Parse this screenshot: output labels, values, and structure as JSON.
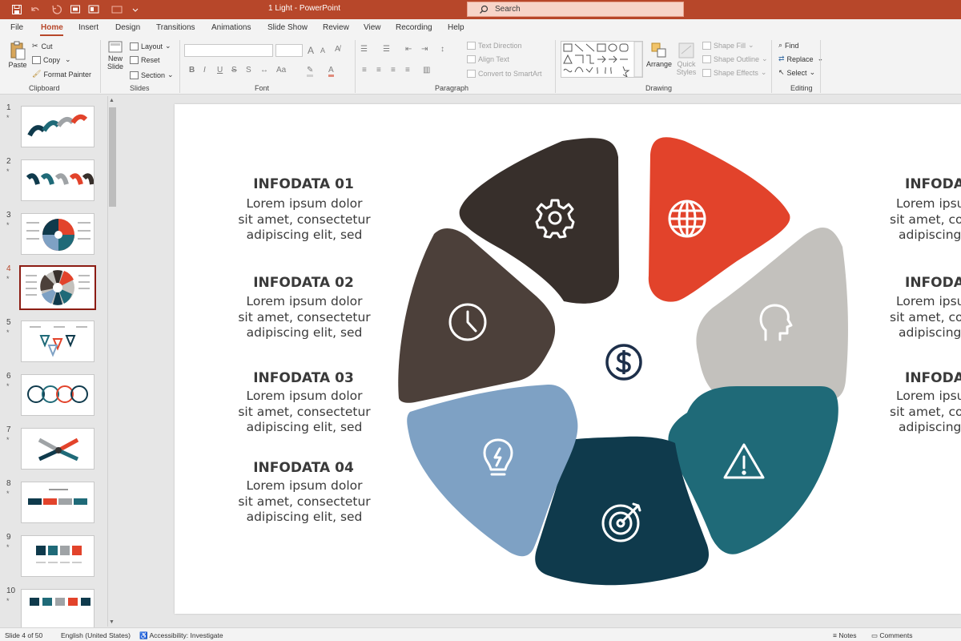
{
  "title_bar": {
    "doc_title": "1 Light  -  PowerPoint",
    "search_placeholder": "Search",
    "bg_color": "#b7472a"
  },
  "tabs": [
    "File",
    "Home",
    "Insert",
    "Design",
    "Transitions",
    "Animations",
    "Slide Show",
    "Review",
    "View",
    "Recording",
    "Help"
  ],
  "ribbon": {
    "clipboard": {
      "paste": "Paste",
      "cut": "Cut",
      "copy": "Copy",
      "format_painter": "Format Painter",
      "label": "Clipboard"
    },
    "slides": {
      "new_slide_1": "New",
      "new_slide_2": "Slide",
      "layout": "Layout",
      "reset": "Reset",
      "section": "Section",
      "label": "Slides"
    },
    "font": {
      "label": "Font",
      "bold": "B",
      "italic": "I",
      "underline": "U",
      "strike": "S",
      "grow": "A",
      "shrink": "A"
    },
    "paragraph": {
      "text_direction": "Text Direction",
      "align_text": "Align Text",
      "smartart": "Convert to SmartArt",
      "label": "Paragraph"
    },
    "drawing": {
      "arrange": "Arrange",
      "quick_styles_1": "Quick",
      "quick_styles_2": "Styles",
      "shape_fill": "Shape Fill",
      "shape_outline": "Shape Outline",
      "shape_effects": "Shape Effects",
      "label": "Drawing"
    },
    "editing": {
      "find": "Find",
      "replace": "Replace",
      "select": "Select",
      "label": "Editing"
    }
  },
  "thumbnails": [
    {
      "num": "1",
      "star": "*"
    },
    {
      "num": "2",
      "star": "*"
    },
    {
      "num": "3",
      "star": "*"
    },
    {
      "num": "4",
      "star": "*"
    },
    {
      "num": "5",
      "star": "*"
    },
    {
      "num": "6",
      "star": "*"
    },
    {
      "num": "7",
      "star": "*"
    },
    {
      "num": "8",
      "star": "*"
    },
    {
      "num": "9",
      "star": "*"
    },
    {
      "num": "10",
      "star": "*"
    }
  ],
  "slide": {
    "left_items": [
      {
        "title": "INFODATA 01",
        "lines": [
          "Lorem ipsum dolor",
          "sit amet, consectetur",
          "adipiscing elit, sed"
        ]
      },
      {
        "title": "INFODATA 02",
        "lines": [
          "Lorem ipsum dolor",
          "sit amet, consectetur",
          "adipiscing elit, sed"
        ]
      },
      {
        "title": "INFODATA 03",
        "lines": [
          "Lorem ipsum dolor",
          "sit amet, consectetur",
          "adipiscing elit, sed"
        ]
      },
      {
        "title": "INFODATA 04",
        "lines": [
          "Lorem ipsum dolor",
          "sit amet, consectetur",
          "adipiscing elit, sed"
        ]
      }
    ],
    "right_items": [
      {
        "title": "INFODA",
        "lines": [
          "Lorem ipsu",
          "sit amet, co",
          "adipiscing"
        ]
      },
      {
        "title": "INFODA",
        "lines": [
          "Lorem ipsu",
          "sit amet, co",
          "adipiscing"
        ]
      },
      {
        "title": "INFODA",
        "lines": [
          "Lorem ipsu",
          "sit amet, co",
          "adipiscing"
        ]
      }
    ],
    "segments": [
      {
        "color": "#372f2b",
        "icon": "gear-icon"
      },
      {
        "color": "#e2432b",
        "icon": "globe-icon"
      },
      {
        "color": "#c3c1bd",
        "icon": "head-icon"
      },
      {
        "color": "#1f6a78",
        "icon": "warning-icon"
      },
      {
        "color": "#0f3a4c",
        "icon": "target-icon"
      },
      {
        "color": "#7ea1c4",
        "icon": "lightbulb-icon"
      },
      {
        "color": "#4c403a",
        "icon": "clock-icon"
      }
    ],
    "center_icon": "dollar-icon"
  },
  "status_bar": {
    "slide_info": "Slide 4 of 50",
    "language": "English (United States)",
    "accessibility": "Accessibility: Investigate",
    "notes": "Notes",
    "comments": "Comments"
  }
}
